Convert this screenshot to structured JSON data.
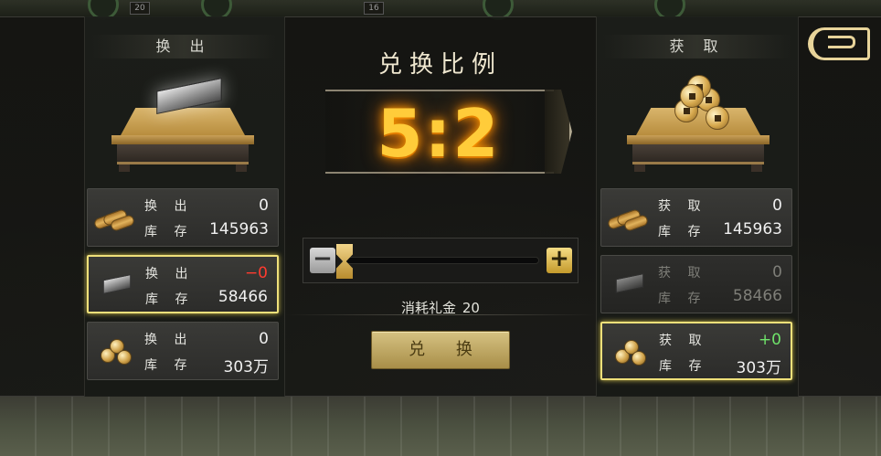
{
  "background": {
    "top_chips": [
      "20",
      "16"
    ]
  },
  "left": {
    "header": "换 出",
    "items": [
      {
        "label1": "换 出",
        "value1": "0",
        "label2": "库 存",
        "value2": "145963"
      },
      {
        "label1": "换 出",
        "value1": "−0",
        "label2": "库 存",
        "value2": "58466"
      },
      {
        "label1": "换 出",
        "value1": "0",
        "label2": "库 存",
        "value2": "303万"
      }
    ]
  },
  "right": {
    "header": "获 取",
    "items": [
      {
        "label1": "获 取",
        "value1": "0",
        "label2": "库 存",
        "value2": "145963"
      },
      {
        "label1": "获 取",
        "value1": "0",
        "label2": "库 存",
        "value2": "58466"
      },
      {
        "label1": "获 取",
        "value1": "+0",
        "label2": "库 存",
        "value2": "303万"
      }
    ]
  },
  "center": {
    "title": "兑换比例",
    "ratio": "5:2",
    "slider": {
      "minus": "−",
      "plus": "+",
      "value_fraction": 0.0
    },
    "cost_label": "消耗礼金",
    "cost_value": "20",
    "exchange_button": "兑 换"
  },
  "colors": {
    "selected_border": "#efe07a",
    "negative": "#ff3b2f",
    "positive": "#6fe36a",
    "ratio_glow": "#ffcc3a"
  }
}
